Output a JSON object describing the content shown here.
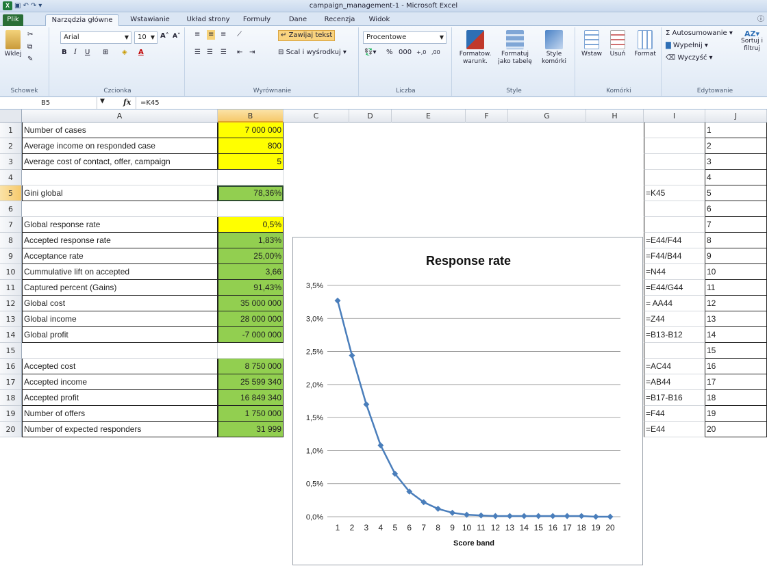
{
  "window": {
    "title": "campaign_management-1 - Microsoft Excel"
  },
  "tabs": [
    "Plik",
    "Narzędzia główne",
    "Wstawianie",
    "Układ strony",
    "Formuły",
    "Dane",
    "Recenzja",
    "Widok"
  ],
  "ribbon": {
    "clipboard": {
      "paste": "Wklej",
      "label": "Schowek"
    },
    "font": {
      "name": "Arial",
      "size": "10",
      "label": "Czcionka"
    },
    "alignment": {
      "wrap": "Zawijaj tekst",
      "merge": "Scal i wyśrodkuj",
      "label": "Wyrównanie"
    },
    "number": {
      "format": "Procentowe",
      "percent": "%",
      "thousands": "000",
      "label": "Liczba"
    },
    "styles": {
      "cond": "Formatow. warunk.",
      "table": "Formatuj jako tabelę",
      "cell": "Style komórki",
      "label": "Style"
    },
    "cells": {
      "insert": "Wstaw",
      "delete": "Usuń",
      "format": "Format",
      "label": "Komórki"
    },
    "editing": {
      "autosum": "Autosumowanie",
      "fill": "Wypełnij",
      "clear": "Wyczyść",
      "sort": "Sortuj i filtruj",
      "label": "Edytowanie"
    }
  },
  "formula_bar": {
    "name_box": "B5",
    "fx": "fx",
    "formula": "=K45"
  },
  "columns": [
    "A",
    "B",
    "C",
    "D",
    "E",
    "F",
    "G",
    "H",
    "I",
    "J"
  ],
  "rows": [
    {
      "n": "1",
      "a": "Number of cases",
      "b": "7 000 000",
      "i": "",
      "j": "1",
      "style": "yel"
    },
    {
      "n": "2",
      "a": "Average income on responded case",
      "b": "800",
      "i": "",
      "j": "2",
      "style": "yel"
    },
    {
      "n": "3",
      "a": "Average cost of contact, offer, campaign",
      "b": "5",
      "i": "",
      "j": "3",
      "style": "yel"
    },
    {
      "n": "4",
      "a": "",
      "b": "",
      "i": "",
      "j": "4",
      "style": ""
    },
    {
      "n": "5",
      "a": "Gini global",
      "b": "78,36%",
      "i": "=K45",
      "j": "5",
      "style": "grn"
    },
    {
      "n": "6",
      "a": "",
      "b": "",
      "i": "",
      "j": "6",
      "style": ""
    },
    {
      "n": "7",
      "a": "Global response rate",
      "b": "0,5%",
      "i": "",
      "j": "7",
      "style": "yel"
    },
    {
      "n": "8",
      "a": "Accepted response rate",
      "b": "1,83%",
      "i": "=E44/F44",
      "j": "8",
      "style": "grn"
    },
    {
      "n": "9",
      "a": "Acceptance rate",
      "b": "25,00%",
      "i": "=F44/B44",
      "j": "9",
      "style": "grn"
    },
    {
      "n": "10",
      "a": "Cummulative lift on accepted",
      "b": "3,66",
      "i": "=N44",
      "j": "10",
      "style": "grn"
    },
    {
      "n": "11",
      "a": "Captured percent (Gains)",
      "b": "91,43%",
      "i": "=E44/G44",
      "j": "11",
      "style": "grn"
    },
    {
      "n": "12",
      "a": "Global cost",
      "b": "35 000 000",
      "i": "= AA44",
      "j": "12",
      "style": "grn"
    },
    {
      "n": "13",
      "a": "Global income",
      "b": "28 000 000",
      "i": "=Z44",
      "j": "13",
      "style": "grn"
    },
    {
      "n": "14",
      "a": "Global profit",
      "b": "-7 000 000",
      "i": "=B13-B12",
      "j": "14",
      "style": "grn"
    },
    {
      "n": "15",
      "a": "",
      "b": "",
      "i": "",
      "j": "15",
      "style": ""
    },
    {
      "n": "16",
      "a": "Accepted cost",
      "b": "8 750 000",
      "i": "=AC44",
      "j": "16",
      "style": "grn"
    },
    {
      "n": "17",
      "a": "Accepted income",
      "b": "25 599 340",
      "i": " =AB44",
      "j": "17",
      "style": "grn"
    },
    {
      "n": "18",
      "a": "Accepted profit",
      "b": "16 849 340",
      "i": "=B17-B16",
      "j": "18",
      "style": "grn"
    },
    {
      "n": "19",
      "a": "Number of offers",
      "b": "1 750 000",
      "i": "=F44",
      "j": "19",
      "style": "grn"
    },
    {
      "n": "20",
      "a": "Number of expected responders",
      "b": "31 999",
      "i": "=E44",
      "j": "20",
      "style": "grn"
    }
  ],
  "chart_data": {
    "type": "line",
    "title": "Response rate",
    "xlabel": "Score band",
    "ylabel": "",
    "x": [
      1,
      2,
      3,
      4,
      5,
      6,
      7,
      8,
      9,
      10,
      11,
      12,
      13,
      14,
      15,
      16,
      17,
      18,
      19,
      20
    ],
    "x_ticks": [
      "1",
      "2",
      "3",
      "4",
      "5",
      "6",
      "7",
      "8",
      "9",
      "10",
      "11",
      "12",
      "13",
      "14",
      "15",
      "16",
      "17",
      "18",
      "19",
      "20"
    ],
    "y_ticks": [
      "0,0%",
      "0,5%",
      "1,0%",
      "1,5%",
      "2,0%",
      "2,5%",
      "3,0%",
      "3,5%"
    ],
    "ylim": [
      0,
      0.035
    ],
    "grid": true,
    "legend": "none",
    "color": "#4a7ebb",
    "series": [
      {
        "values": [
          0.0327,
          0.0244,
          0.017,
          0.0108,
          0.0065,
          0.0038,
          0.0022,
          0.0012,
          0.0006,
          0.0003,
          0.0002,
          0.0001,
          0.0001,
          0.0001,
          0.0001,
          0.0001,
          0.0001,
          0.0001,
          0.0,
          0.0
        ]
      }
    ]
  }
}
